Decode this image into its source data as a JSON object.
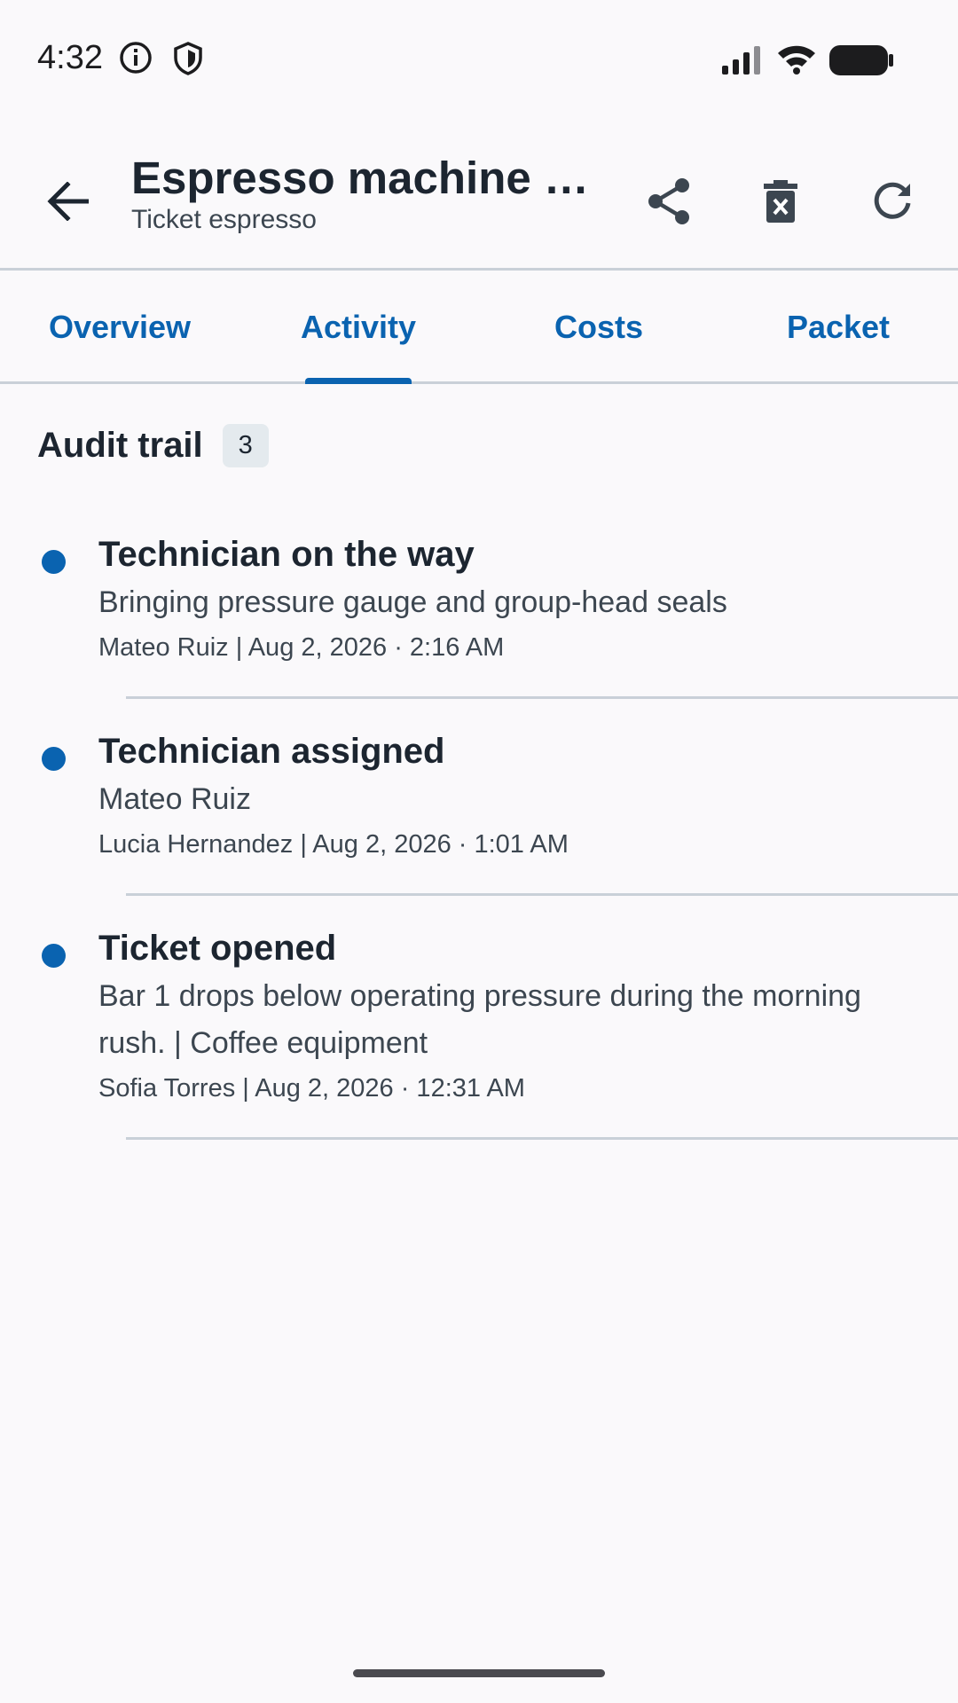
{
  "status_bar": {
    "time": "4:32",
    "icons": [
      "info-icon",
      "shield-icon",
      "signal-icon",
      "wifi-icon",
      "battery-icon"
    ]
  },
  "app_bar": {
    "title": "Espresso machine lo…",
    "subtitle": "Ticket espresso",
    "icons": [
      "back-arrow-icon",
      "share-icon",
      "delete-icon",
      "refresh-icon"
    ]
  },
  "tabs": [
    {
      "label": "Overview",
      "selected": false
    },
    {
      "label": "Activity",
      "selected": true
    },
    {
      "label": "Costs",
      "selected": false
    },
    {
      "label": "Packet",
      "selected": false
    }
  ],
  "section": {
    "title": "Audit trail",
    "count": "3"
  },
  "timeline": [
    {
      "title": "Technician on the way",
      "body": "Bringing pressure gauge and group-head seals",
      "meta": "Mateo Ruiz  |  Aug 2, 2026 · 2:16 AM"
    },
    {
      "title": "Technician assigned",
      "body": "Mateo Ruiz",
      "meta": "Lucia Hernandez  |  Aug 2, 2026 · 1:01 AM"
    },
    {
      "title": "Ticket opened",
      "body": "Bar 1 drops below operating pressure during the morning rush. | Coffee equipment",
      "meta": "Sofia Torres  |  Aug 2, 2026 · 12:31 AM"
    }
  ],
  "colors": {
    "accent": "#0a63b0",
    "background": "#faf9fb",
    "divider": "#c9d0d8",
    "text_primary": "#1c2530",
    "text_secondary": "#3c4650"
  }
}
